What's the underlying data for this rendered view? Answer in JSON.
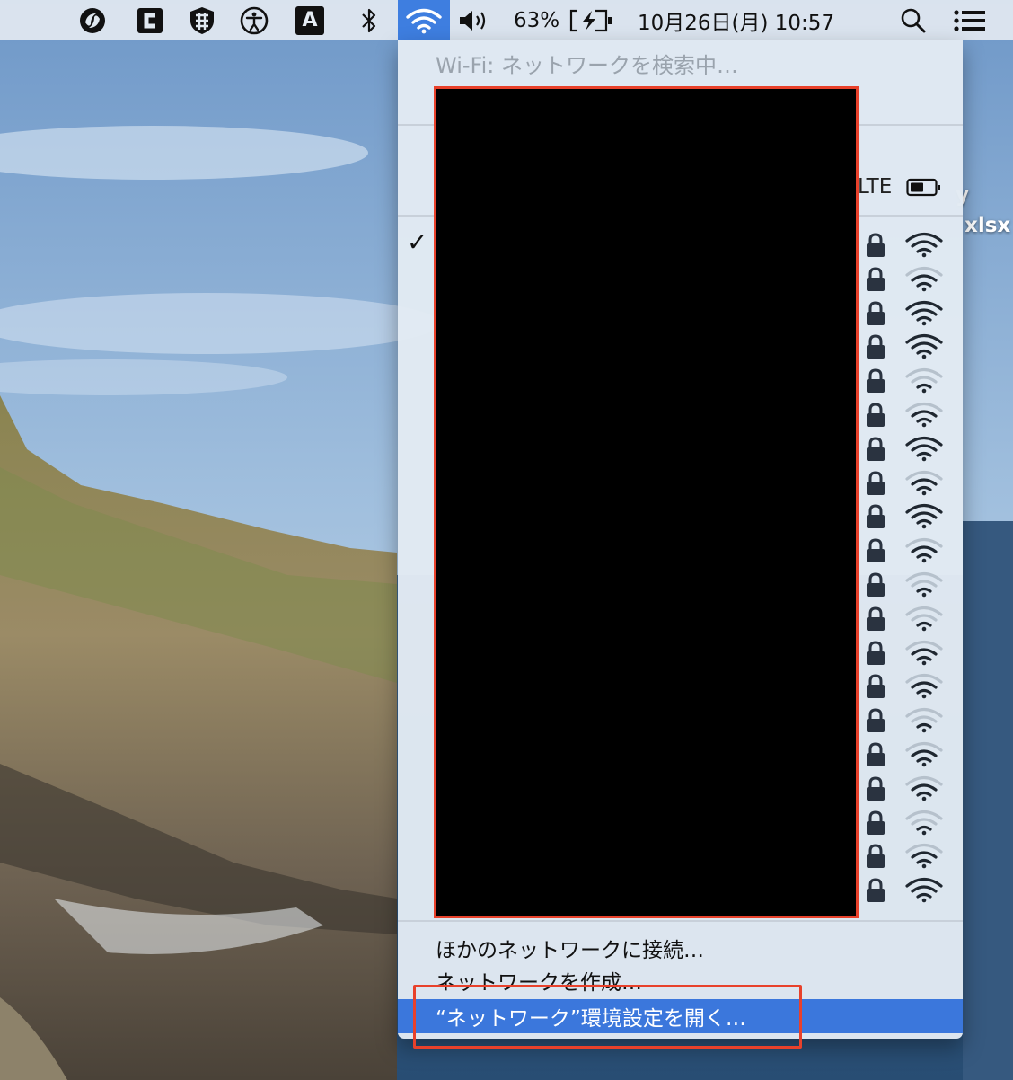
{
  "menubar": {
    "battery_percent": "63%",
    "clock": "10月26日(月)  10:57",
    "input_source_label": "A",
    "icons": [
      "sync-app-icon",
      "c-app-icon",
      "shield-app-icon",
      "accessibility-icon",
      "input-source-icon",
      "bluetooth-icon",
      "wifi-icon",
      "volume-icon",
      "battery-charging-icon",
      "spotlight-search-icon",
      "notification-center-icon"
    ]
  },
  "desktop": {
    "labels": [
      "y",
      "xlsx"
    ]
  },
  "wifi_menu": {
    "status": "Wi-Fi: ネットワークを検索中…",
    "hotspot_tail": "LTE",
    "connected_mark": "✓",
    "networks": [
      {
        "locked": true,
        "strength": 3
      },
      {
        "locked": true,
        "strength": 2
      },
      {
        "locked": true,
        "strength": 3
      },
      {
        "locked": true,
        "strength": 3
      },
      {
        "locked": true,
        "strength": 1
      },
      {
        "locked": true,
        "strength": 2
      },
      {
        "locked": true,
        "strength": 3
      },
      {
        "locked": true,
        "strength": 2
      },
      {
        "locked": true,
        "strength": 3
      },
      {
        "locked": true,
        "strength": 2
      },
      {
        "locked": true,
        "strength": 1
      },
      {
        "locked": true,
        "strength": 1
      },
      {
        "locked": true,
        "strength": 2
      },
      {
        "locked": true,
        "strength": 2
      },
      {
        "locked": true,
        "strength": 1
      },
      {
        "locked": true,
        "strength": 2
      },
      {
        "locked": true,
        "strength": 2
      },
      {
        "locked": true,
        "strength": 1
      },
      {
        "locked": true,
        "strength": 2
      },
      {
        "locked": true,
        "strength": 3
      }
    ],
    "actions": {
      "join_other": "ほかのネットワークに接続…",
      "create_network": "ネットワークを作成…",
      "open_prefs": "“ネットワーク”環境設定を開く…"
    }
  },
  "colors": {
    "highlight": "#3b77dc",
    "annotation_red": "#e8412b",
    "wifi_active_bg": "#3e7ee0"
  }
}
